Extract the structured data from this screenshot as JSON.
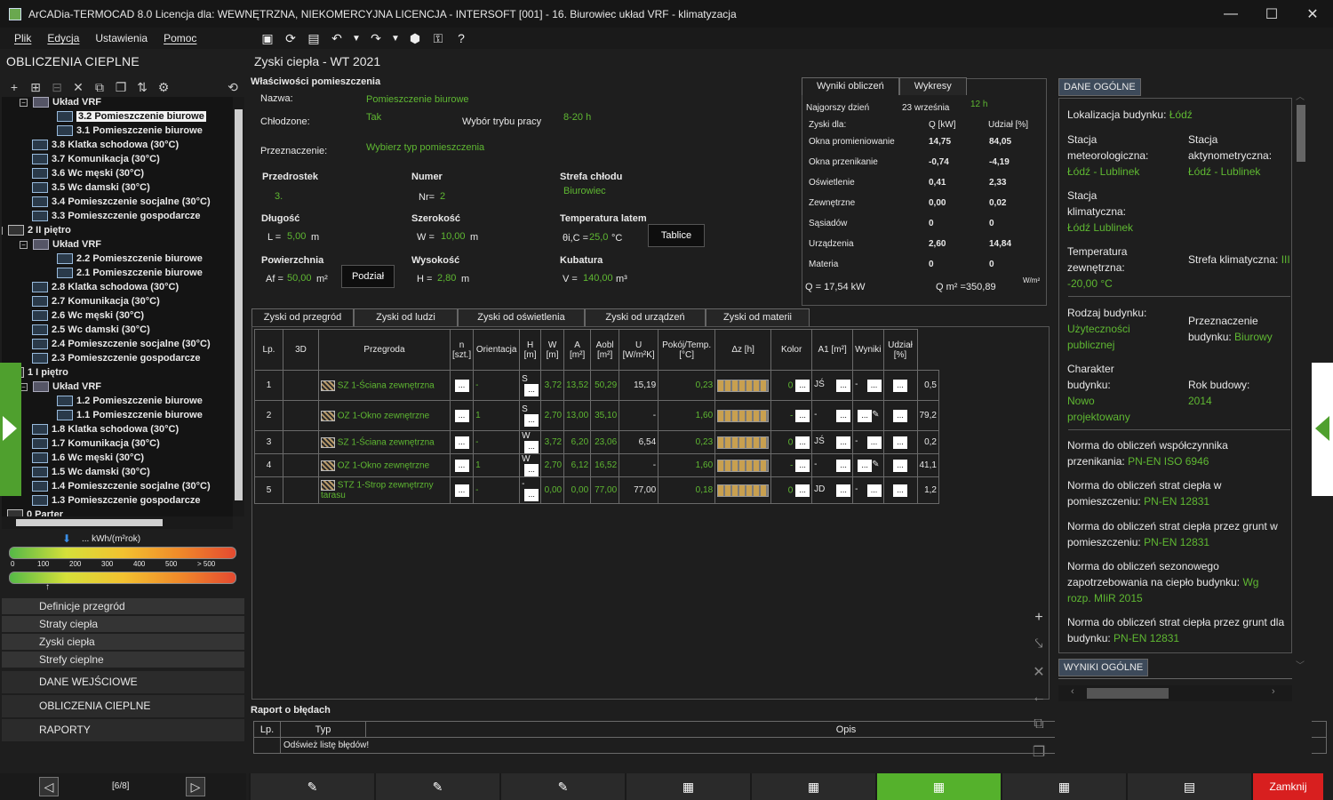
{
  "window": {
    "title": "ArCADia-TERMOCAD 8.0 Licencja dla: WEWNĘTRZNA, NIEKOMERCYJNA LICENCJA - INTERSOFT [001] - 16. Biurowiec układ VRF - klimatyzacja",
    "min": "—",
    "max": "☐",
    "close": "✕"
  },
  "menu": [
    "Plik",
    "Edycja",
    "Ustawienia",
    "Pomoc"
  ],
  "toolbar_icons": [
    "save-icon",
    "refresh-icon",
    "report-icon",
    "undo-icon",
    "dropdown-icon",
    "redo-icon",
    "dropdown-icon",
    "cube-icon",
    "lock-icon",
    "help-icon"
  ],
  "left": {
    "title": "OBLICZENIA CIEPLNE",
    "tree": [
      {
        "label": "Układ VRF",
        "depth": 2,
        "type": "fold",
        "exp": "−"
      },
      {
        "label": "3.2 Pomieszczenie biurowe",
        "depth": 3,
        "type": "room",
        "sel": true
      },
      {
        "label": "3.1 Pomieszczenie biurowe",
        "depth": 3,
        "type": "room"
      },
      {
        "label": "3.8 Klatka schodowa (30°C)",
        "depth": 2,
        "type": "room"
      },
      {
        "label": "3.7 Komunikacja (30°C)",
        "depth": 2,
        "type": "room"
      },
      {
        "label": "3.6 Wc męski (30°C)",
        "depth": 2,
        "type": "room"
      },
      {
        "label": "3.5 Wc damski (30°C)",
        "depth": 2,
        "type": "room"
      },
      {
        "label": "3.4 Pomieszczenie socjalne (30°C)",
        "depth": 2,
        "type": "room"
      },
      {
        "label": "3.3 Pomieszczenie gospodarcze",
        "depth": 2,
        "type": "room"
      },
      {
        "label": "2 II piętro",
        "depth": 1,
        "type": "floor",
        "exp": "−"
      },
      {
        "label": "Układ VRF",
        "depth": 2,
        "type": "fold",
        "exp": "−"
      },
      {
        "label": "2.2 Pomieszczenie biurowe",
        "depth": 3,
        "type": "room"
      },
      {
        "label": "2.1 Pomieszczenie biurowe",
        "depth": 3,
        "type": "room"
      },
      {
        "label": "2.8 Klatka schodowa (30°C)",
        "depth": 2,
        "type": "room"
      },
      {
        "label": "2.7 Komunikacja (30°C)",
        "depth": 2,
        "type": "room"
      },
      {
        "label": "2.6 Wc męski (30°C)",
        "depth": 2,
        "type": "room"
      },
      {
        "label": "2.5 Wc damski (30°C)",
        "depth": 2,
        "type": "room"
      },
      {
        "label": "2.4 Pomieszczenie socjalne (30°C)",
        "depth": 2,
        "type": "room"
      },
      {
        "label": "2.3 Pomieszczenie gospodarcze",
        "depth": 2,
        "type": "room"
      },
      {
        "label": "1 I piętro",
        "depth": 1,
        "type": "floor",
        "exp": "−"
      },
      {
        "label": "Układ VRF",
        "depth": 2,
        "type": "fold",
        "exp": "−"
      },
      {
        "label": "1.2 Pomieszczenie biurowe",
        "depth": 3,
        "type": "room"
      },
      {
        "label": "1.1 Pomieszczenie biurowe",
        "depth": 3,
        "type": "room"
      },
      {
        "label": "1.8 Klatka schodowa (30°C)",
        "depth": 2,
        "type": "room"
      },
      {
        "label": "1.7 Komunikacja (30°C)",
        "depth": 2,
        "type": "room"
      },
      {
        "label": "1.6 Wc męski (30°C)",
        "depth": 2,
        "type": "room"
      },
      {
        "label": "1.5 Wc damski (30°C)",
        "depth": 2,
        "type": "room"
      },
      {
        "label": "1.4 Pomieszczenie socjalne (30°C)",
        "depth": 2,
        "type": "room"
      },
      {
        "label": "1.3 Pomieszczenie gospodarcze",
        "depth": 2,
        "type": "room"
      },
      {
        "label": "0 Parter",
        "depth": 1,
        "type": "floor"
      }
    ],
    "energy_unit": "... kWh/(m²rok)",
    "energy_ticks": [
      "0",
      "100",
      "200",
      "300",
      "400",
      "500",
      "> 500"
    ],
    "nav": [
      "Definicje przegród",
      "Straty ciepła",
      "Zyski ciepła",
      "Strefy cieplne"
    ],
    "nav_big": [
      "DANE WEJŚCIOWE",
      "OBLICZENIA CIEPLNE",
      "RAPORTY"
    ],
    "pager": {
      "prev": "◁",
      "label": "[6/8]",
      "next": "▷"
    }
  },
  "main": {
    "title": "Zyski ciepła - WT 2021",
    "props_title": "Właściwości pomieszczenia",
    "nazwa_label": "Nazwa:",
    "nazwa": "Pomieszczenie biurowe",
    "chlodzone_label": "Chłodzone:",
    "chlodzone": "Tak",
    "tryb_label": "Wybór trybu pracy",
    "tryb": "8-20 h",
    "przezn_label": "Przeznaczenie:",
    "przezn": "Wybierz typ pomieszczenia",
    "przedrostek_label": "Przedrostek",
    "przedrostek": "3.",
    "numer_label": "Numer",
    "nr_label": "Nr=",
    "nr": "2",
    "strefa_label": "Strefa chłodu",
    "strefa": "Biurowiec",
    "dlugosc_label": "Długość",
    "l_label": "L =",
    "l": "5,00",
    "l_unit": "m",
    "szer_label": "Szerokość",
    "w_label": "W =",
    "w": "10,00",
    "w_unit": "m",
    "temp_label": "Temperatura latem",
    "theta_label": "θi,C =",
    "theta": "25,0",
    "theta_unit": "°C",
    "tablice": "Tablice",
    "pow_label": "Powierzchnia",
    "af_label": "Af =",
    "af": "50,00",
    "af_unit": "m²",
    "podzial": "Podział",
    "wys_label": "Wysokość",
    "h_label": "H =",
    "h": "2,80",
    "h_unit": "m",
    "kub_label": "Kubatura",
    "v_label": "V =",
    "v": "140,00",
    "v_unit": "m³"
  },
  "results": {
    "tabs": [
      "Wyniki obliczeń",
      "Wykresy"
    ],
    "worst_label": "Najgorszy dzień",
    "worst_date": "23 września",
    "worst_hour": "12 h",
    "gains_label": "Zyski dla:",
    "q_col": "Q [kW]",
    "share_col": "Udział [%]",
    "rows": [
      {
        "name": "Okna promieniowanie",
        "q": "14,75",
        "share": "84,05"
      },
      {
        "name": "Okna przenikanie",
        "q": "-0,74",
        "share": "-4,19"
      },
      {
        "name": "Oświetlenie",
        "q": "0,41",
        "share": "2,33"
      },
      {
        "name": "Zewnętrzne",
        "q": "0,00",
        "share": "0,02"
      },
      {
        "name": "Sąsiadów",
        "q": "0",
        "share": "0"
      },
      {
        "name": "Urządzenia",
        "q": "2,60",
        "share": "14,84"
      },
      {
        "name": "Materia",
        "q": "0",
        "share": "0"
      }
    ],
    "q_total_label": "Q = 17,54  kW",
    "qm2_label": "Q m² =350,89",
    "qm2_unit": "W/m²"
  },
  "tabs2": [
    "Zyski od przegród",
    "Zyski od ludzi",
    "Zyski od oświetlenia",
    "Zyski od urządzeń",
    "Zyski od materii"
  ],
  "table": {
    "headers": [
      "Lp.",
      "3D",
      "Przegroda",
      "n [szt.]",
      "Orientacja",
      "H [m]",
      "W [m]",
      "A [m²]",
      "Aobl [m²]",
      "U [W/m²K]",
      "Pokój/Temp. [°C]",
      "Δz [h]",
      "Kolor",
      "A1 [m²]",
      "Wyniki",
      "Udział [%]"
    ],
    "rows": [
      {
        "lp": "1",
        "przegroda": "SZ 1-Ściana zewnętrzna",
        "n": "-",
        "or": "S",
        "h": "3,72",
        "w": "13,52",
        "a": "50,29",
        "aobl": "15,19",
        "u": "0,23",
        "dz": "0",
        "kolor": "JŚ",
        "a1": "-",
        "udzial": "0,5"
      },
      {
        "lp": "2",
        "przegroda": "OZ 1-Okno zewnętrzne",
        "n": "1",
        "or": "S",
        "h": "2,70",
        "w": "13,00",
        "a": "35,10",
        "aobl": "-",
        "u": "1,60",
        "dz": "-",
        "kolor": "-",
        "a1": "",
        "udzial": "79,2"
      },
      {
        "lp": "3",
        "przegroda": "SZ 1-Ściana zewnętrzna",
        "n": "-",
        "or": "W",
        "h": "3,72",
        "w": "6,20",
        "a": "23,06",
        "aobl": "6,54",
        "u": "0,23",
        "dz": "0",
        "kolor": "JŚ",
        "a1": "-",
        "udzial": "0,2"
      },
      {
        "lp": "4",
        "przegroda": "OZ 1-Okno zewnętrzne",
        "n": "1",
        "or": "W",
        "h": "2,70",
        "w": "6,12",
        "a": "16,52",
        "aobl": "-",
        "u": "1,60",
        "dz": "-",
        "kolor": "-",
        "a1": "",
        "udzial": "41,1"
      },
      {
        "lp": "5",
        "przegroda": "STZ 1-Strop zewnętrzny tarasu",
        "n": "-",
        "or": "-",
        "h": "0,00",
        "w": "0,00",
        "a": "77,00",
        "aobl": "77,00",
        "u": "0,18",
        "dz": "0",
        "kolor": "JD",
        "a1": "-",
        "udzial": "1,2"
      }
    ]
  },
  "raport": {
    "title": "Raport o błędach",
    "cols": [
      "Lp.",
      "Typ",
      "Opis"
    ],
    "msg": "Odśwież listę błędów!"
  },
  "right": {
    "head": "DANE OGÓLNE",
    "lok_label": "Lokalizacja budynku:",
    "lok": "Łódź",
    "stm_label": "Stacja meteorologiczna:",
    "stm": "Łódź - Lublinek",
    "sta_label": "Stacja aktynometryczna:",
    "sta": "Łódź - Lublinek",
    "stk_label": "Stacja klimatyczna:",
    "stk": "Łódź Lublinek",
    "tz_label": "Temperatura zewnętrzna:",
    "tz": "-20,00 °C",
    "sk_label": "Strefa klimatyczna:",
    "sk": "III",
    "rb_label": "Rodzaj budynku:",
    "rb": "Użyteczności publicznej",
    "pb_label": "Przeznaczenie budynku:",
    "pb": "Biurowy",
    "cb_label": "Charakter budynku:",
    "cb": "Nowo projektowany",
    "rok_label": "Rok budowy:",
    "rok": "2014",
    "n1_label": "Norma do obliczeń współczynnika przenikania:",
    "n1": "PN-EN ISO 6946",
    "n2_label": "Norma do obliczeń strat ciepła w pomieszczeniu:",
    "n2": "PN-EN 12831",
    "n3_label": "Norma do obliczeń strat ciepła przez grunt w pomieszczeniu:",
    "n3": "PN-EN 12831",
    "n4_label": "Norma do obliczeń sezonowego zapotrzebowania na ciepło budynku:",
    "n4": "Wg rozp. MIiR 2015",
    "n5_label": "Norma do obliczeń strat ciepła przez grunt dla budynku:",
    "n5": "PN-EN 12831",
    "wyniki_head": "WYNIKI OGÓLNE"
  },
  "bottom": {
    "close": "Zamknij"
  },
  "colors": {
    "accent": "#55b12c",
    "value": "#5fb832",
    "close": "#d81f1f"
  }
}
